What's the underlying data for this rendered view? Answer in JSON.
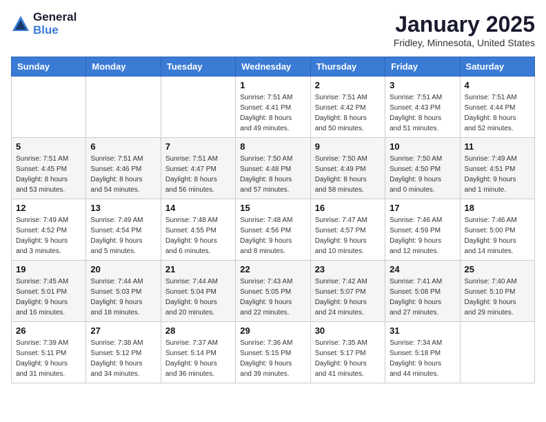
{
  "header": {
    "logo_general": "General",
    "logo_blue": "Blue",
    "month": "January 2025",
    "location": "Fridley, Minnesota, United States"
  },
  "days_of_week": [
    "Sunday",
    "Monday",
    "Tuesday",
    "Wednesday",
    "Thursday",
    "Friday",
    "Saturday"
  ],
  "weeks": [
    [
      {
        "day": "",
        "info": ""
      },
      {
        "day": "",
        "info": ""
      },
      {
        "day": "",
        "info": ""
      },
      {
        "day": "1",
        "info": "Sunrise: 7:51 AM\nSunset: 4:41 PM\nDaylight: 8 hours\nand 49 minutes."
      },
      {
        "day": "2",
        "info": "Sunrise: 7:51 AM\nSunset: 4:42 PM\nDaylight: 8 hours\nand 50 minutes."
      },
      {
        "day": "3",
        "info": "Sunrise: 7:51 AM\nSunset: 4:43 PM\nDaylight: 8 hours\nand 51 minutes."
      },
      {
        "day": "4",
        "info": "Sunrise: 7:51 AM\nSunset: 4:44 PM\nDaylight: 8 hours\nand 52 minutes."
      }
    ],
    [
      {
        "day": "5",
        "info": "Sunrise: 7:51 AM\nSunset: 4:45 PM\nDaylight: 8 hours\nand 53 minutes."
      },
      {
        "day": "6",
        "info": "Sunrise: 7:51 AM\nSunset: 4:46 PM\nDaylight: 8 hours\nand 54 minutes."
      },
      {
        "day": "7",
        "info": "Sunrise: 7:51 AM\nSunset: 4:47 PM\nDaylight: 8 hours\nand 56 minutes."
      },
      {
        "day": "8",
        "info": "Sunrise: 7:50 AM\nSunset: 4:48 PM\nDaylight: 8 hours\nand 57 minutes."
      },
      {
        "day": "9",
        "info": "Sunrise: 7:50 AM\nSunset: 4:49 PM\nDaylight: 8 hours\nand 58 minutes."
      },
      {
        "day": "10",
        "info": "Sunrise: 7:50 AM\nSunset: 4:50 PM\nDaylight: 9 hours\nand 0 minutes."
      },
      {
        "day": "11",
        "info": "Sunrise: 7:49 AM\nSunset: 4:51 PM\nDaylight: 9 hours\nand 1 minute."
      }
    ],
    [
      {
        "day": "12",
        "info": "Sunrise: 7:49 AM\nSunset: 4:52 PM\nDaylight: 9 hours\nand 3 minutes."
      },
      {
        "day": "13",
        "info": "Sunrise: 7:49 AM\nSunset: 4:54 PM\nDaylight: 9 hours\nand 5 minutes."
      },
      {
        "day": "14",
        "info": "Sunrise: 7:48 AM\nSunset: 4:55 PM\nDaylight: 9 hours\nand 6 minutes."
      },
      {
        "day": "15",
        "info": "Sunrise: 7:48 AM\nSunset: 4:56 PM\nDaylight: 9 hours\nand 8 minutes."
      },
      {
        "day": "16",
        "info": "Sunrise: 7:47 AM\nSunset: 4:57 PM\nDaylight: 9 hours\nand 10 minutes."
      },
      {
        "day": "17",
        "info": "Sunrise: 7:46 AM\nSunset: 4:59 PM\nDaylight: 9 hours\nand 12 minutes."
      },
      {
        "day": "18",
        "info": "Sunrise: 7:46 AM\nSunset: 5:00 PM\nDaylight: 9 hours\nand 14 minutes."
      }
    ],
    [
      {
        "day": "19",
        "info": "Sunrise: 7:45 AM\nSunset: 5:01 PM\nDaylight: 9 hours\nand 16 minutes."
      },
      {
        "day": "20",
        "info": "Sunrise: 7:44 AM\nSunset: 5:03 PM\nDaylight: 9 hours\nand 18 minutes."
      },
      {
        "day": "21",
        "info": "Sunrise: 7:44 AM\nSunset: 5:04 PM\nDaylight: 9 hours\nand 20 minutes."
      },
      {
        "day": "22",
        "info": "Sunrise: 7:43 AM\nSunset: 5:05 PM\nDaylight: 9 hours\nand 22 minutes."
      },
      {
        "day": "23",
        "info": "Sunrise: 7:42 AM\nSunset: 5:07 PM\nDaylight: 9 hours\nand 24 minutes."
      },
      {
        "day": "24",
        "info": "Sunrise: 7:41 AM\nSunset: 5:08 PM\nDaylight: 9 hours\nand 27 minutes."
      },
      {
        "day": "25",
        "info": "Sunrise: 7:40 AM\nSunset: 5:10 PM\nDaylight: 9 hours\nand 29 minutes."
      }
    ],
    [
      {
        "day": "26",
        "info": "Sunrise: 7:39 AM\nSunset: 5:11 PM\nDaylight: 9 hours\nand 31 minutes."
      },
      {
        "day": "27",
        "info": "Sunrise: 7:38 AM\nSunset: 5:12 PM\nDaylight: 9 hours\nand 34 minutes."
      },
      {
        "day": "28",
        "info": "Sunrise: 7:37 AM\nSunset: 5:14 PM\nDaylight: 9 hours\nand 36 minutes."
      },
      {
        "day": "29",
        "info": "Sunrise: 7:36 AM\nSunset: 5:15 PM\nDaylight: 9 hours\nand 39 minutes."
      },
      {
        "day": "30",
        "info": "Sunrise: 7:35 AM\nSunset: 5:17 PM\nDaylight: 9 hours\nand 41 minutes."
      },
      {
        "day": "31",
        "info": "Sunrise: 7:34 AM\nSunset: 5:18 PM\nDaylight: 9 hours\nand 44 minutes."
      },
      {
        "day": "",
        "info": ""
      }
    ]
  ]
}
